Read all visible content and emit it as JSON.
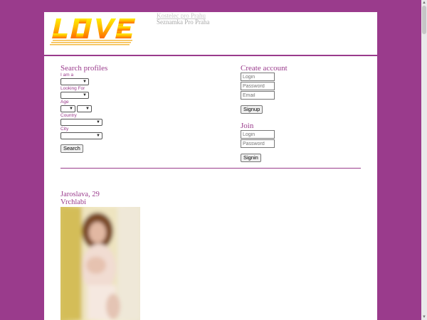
{
  "header": {
    "logo_text": "LOVE",
    "links": [
      "Kostelec pro Prahu",
      "Seznamka Pro Praha"
    ]
  },
  "search": {
    "title": "Search profiles",
    "i_am_label": "I am a",
    "looking_for_label": "Looking For",
    "age_label": "Age",
    "country_label": "Country",
    "city_label": "City",
    "search_button": "Search"
  },
  "create": {
    "title": "Create account",
    "login_placeholder": "Login",
    "password_placeholder": "Password",
    "email_placeholder": "Email",
    "signup_button": "Signup"
  },
  "join": {
    "title": "Join",
    "login_placeholder": "Login",
    "password_placeholder": "Password",
    "signin_button": "Signin"
  },
  "profile": {
    "name_age": "Jaroslava, 29",
    "city": "Vrchlabi"
  },
  "colors": {
    "background": "#9a3b8c",
    "accent": "#9a3b8c"
  }
}
